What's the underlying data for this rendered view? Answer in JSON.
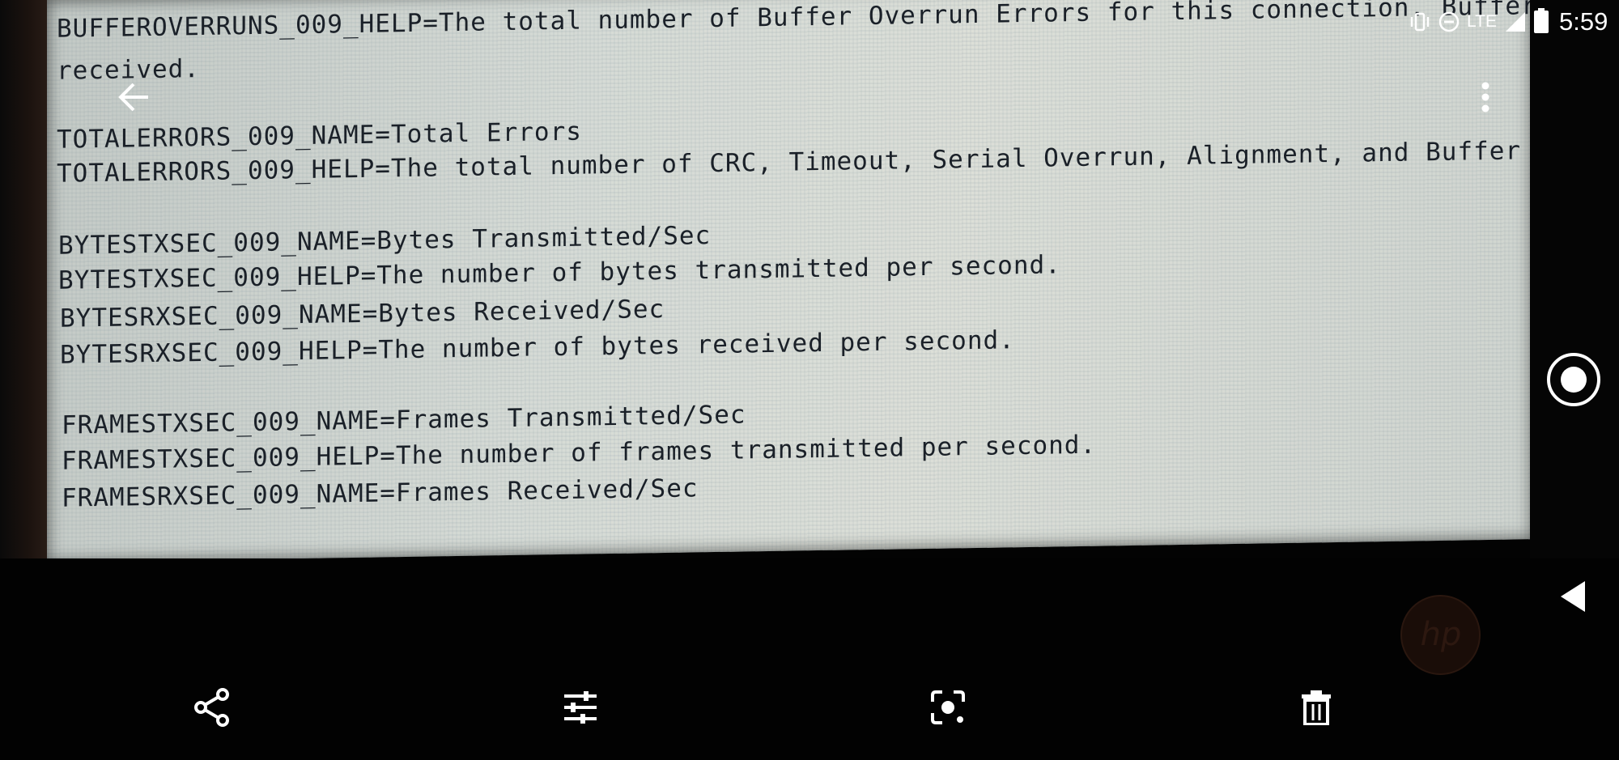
{
  "status_bar": {
    "network": "LTE",
    "time": "5:59"
  },
  "document": {
    "lines": [
      "BUFFEROVERRUNS_009_HELP=The total number of Buffer Overrun Errors for this connection. Buffer Ov",
      "received.",
      "TOTALERRORS_009_NAME=Total Errors",
      "TOTALERRORS_009_HELP=The total number of CRC, Timeout, Serial Overrun, Alignment, and Buffer Over",
      "BYTESTXSEC_009_NAME=Bytes Transmitted/Sec",
      "BYTESTXSEC_009_HELP=The number of bytes transmitted per second.",
      "BYTESRXSEC_009_NAME=Bytes Received/Sec",
      "BYTESRXSEC_009_HELP=The number of bytes received per second.",
      "FRAMESTXSEC_009_NAME=Frames Transmitted/Sec",
      "FRAMESTXSEC_009_HELP=The number of frames transmitted per second.",
      "FRAMESRXSEC_009_NAME=Frames Received/Sec"
    ]
  },
  "icons": {
    "back": "arrow-left-icon",
    "overflow": "more-vert-icon",
    "share": "share-icon",
    "edit": "tune-icon",
    "lens": "lens-icon",
    "delete": "trash-icon",
    "nav_back": "triangle-back-icon",
    "nav_home": "home-circle-icon"
  },
  "colors": {
    "screen_bg": "#d4d9d4",
    "text": "#1a2028",
    "ui": "#ffffff"
  }
}
